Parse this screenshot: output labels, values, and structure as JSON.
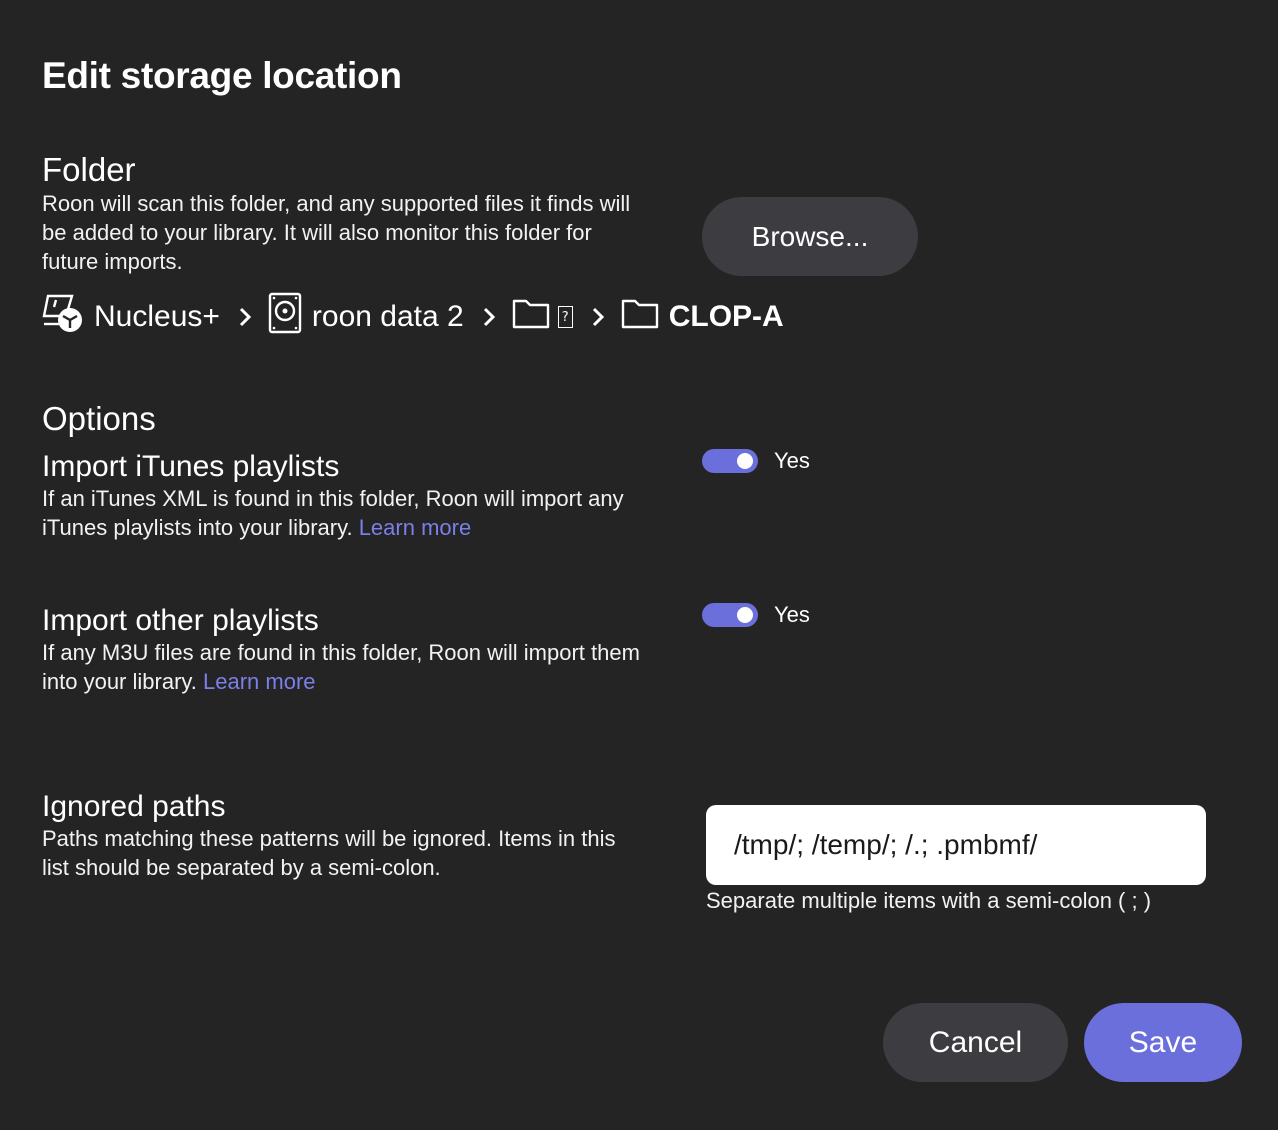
{
  "dialog": {
    "title": "Edit storage location"
  },
  "folder": {
    "heading": "Folder",
    "description": "Roon will scan this folder, and any supported files it finds will be added to your library. It will also monitor this folder for future imports.",
    "browse_label": "Browse...",
    "breadcrumb": [
      {
        "label": "Nucleus+",
        "icon": "nucleus-device-icon"
      },
      {
        "label": "roon data 2",
        "icon": "hard-drive-icon"
      },
      {
        "label": "?",
        "icon": "folder-icon"
      },
      {
        "label": "CLOP-A",
        "icon": "folder-icon"
      }
    ]
  },
  "options": {
    "heading": "Options",
    "itunes": {
      "title": "Import iTunes playlists",
      "description": "If an iTunes XML is found in this folder, Roon will import any iTunes playlists into your library.",
      "link": "Learn more",
      "toggle_on": true,
      "toggle_label": "Yes"
    },
    "other": {
      "title": "Import other playlists",
      "description": "If any M3U files are found in this folder, Roon will import them into your library.",
      "link": "Learn more",
      "toggle_on": true,
      "toggle_label": "Yes"
    },
    "ignored": {
      "title": "Ignored paths",
      "description": "Paths matching these patterns will be ignored. Items in this list should be separated by a semi-colon.",
      "value": "/tmp/; /temp/; /.; .pmbmf/",
      "hint": "Separate multiple items with a semi-colon ( ; )"
    }
  },
  "footer": {
    "cancel_label": "Cancel",
    "save_label": "Save"
  },
  "colors": {
    "background": "#242424",
    "accent": "#6b6fdc",
    "link": "#7b7fe8",
    "button": "#3c3c41"
  }
}
